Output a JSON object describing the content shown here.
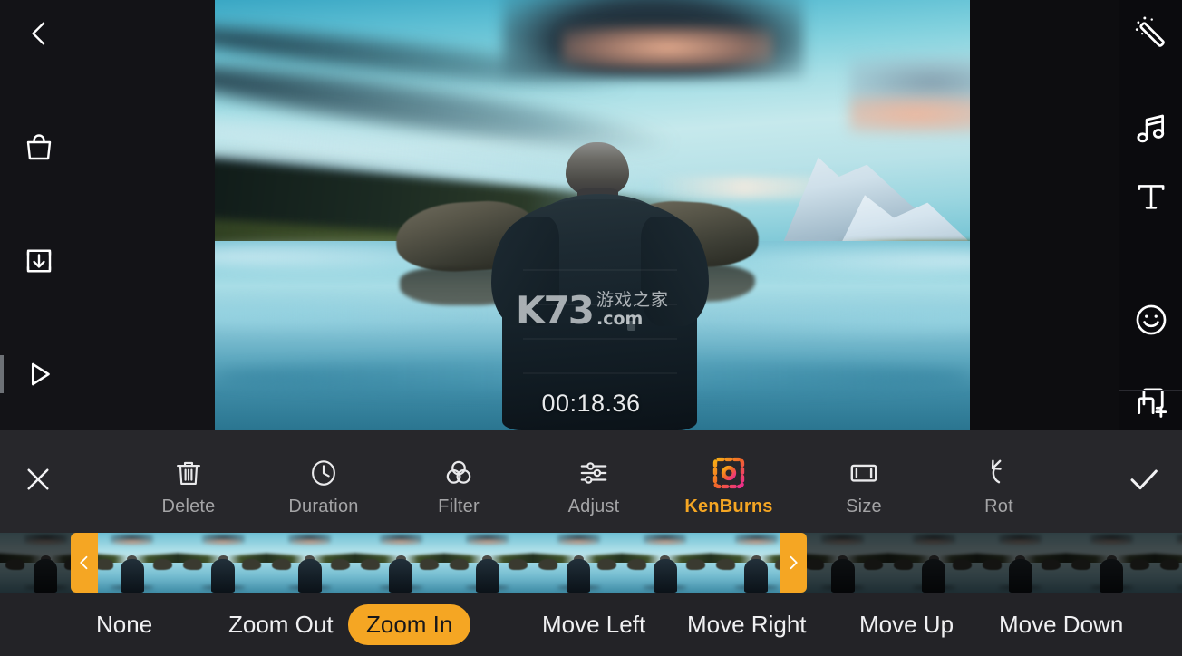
{
  "colors": {
    "accent": "#f5a623",
    "toolbar_bg": "#27272b",
    "options_bg": "#232327",
    "rail_bg": "#131317",
    "label_gray": "#a4a4a6"
  },
  "left_rail": {
    "items": [
      {
        "name": "back-button",
        "icon": "chevron-left-icon",
        "label": "Back"
      },
      {
        "name": "store-button",
        "icon": "shopping-bag-icon",
        "label": "Store"
      },
      {
        "name": "save-button",
        "icon": "download-box-icon",
        "label": "Save"
      },
      {
        "name": "play-button",
        "icon": "play-triangle-icon",
        "label": "Play"
      }
    ]
  },
  "right_rail": {
    "items": [
      {
        "name": "effects-button",
        "icon": "magic-wand-icon",
        "label": "Effects"
      },
      {
        "name": "music-button",
        "icon": "music-note-icon",
        "label": "Music"
      },
      {
        "name": "text-button",
        "icon": "text-t-icon",
        "label": "Text"
      },
      {
        "name": "sticker-button",
        "icon": "smiley-face-icon",
        "label": "Sticker"
      },
      {
        "name": "overlay-button",
        "icon": "add-layer-icon",
        "label": "Overlay"
      }
    ]
  },
  "preview": {
    "timecode": "00:18.36",
    "watermark": {
      "logo": "K73",
      "chinese": "游戏之家",
      "domain": ".com"
    }
  },
  "toolbar": {
    "close_label": "Close",
    "confirm_label": "Confirm",
    "items": [
      {
        "label": "Delete",
        "icon": "trash-icon",
        "active": false
      },
      {
        "label": "Duration",
        "icon": "clock-icon",
        "active": false
      },
      {
        "label": "Filter",
        "icon": "venn-circles-icon",
        "active": false
      },
      {
        "label": "Adjust",
        "icon": "sliders-icon",
        "active": false
      },
      {
        "label": "KenBurns",
        "icon": "kenburns-icon",
        "active": true
      },
      {
        "label": "Size",
        "icon": "film-frame-icon",
        "active": false
      },
      {
        "label": "Rot",
        "icon": "rotate-arrow-icon",
        "active": false
      }
    ]
  },
  "filmstrip": {
    "handle_left_label": "Trim start handle",
    "handle_right_label": "Trim end handle",
    "handle_left_icon": "chevron-left-icon",
    "handle_right_icon": "chevron-right-icon"
  },
  "options": {
    "selected": "Zoom In",
    "items": [
      {
        "label": "None",
        "selected": false
      },
      {
        "label": "Zoom Out",
        "selected": false
      },
      {
        "label": "Zoom In",
        "selected": true
      },
      {
        "label": "Move Left",
        "selected": false
      },
      {
        "label": "Move Right",
        "selected": false
      },
      {
        "label": "Move Up",
        "selected": false
      },
      {
        "label": "Move Down",
        "selected": false
      }
    ]
  }
}
